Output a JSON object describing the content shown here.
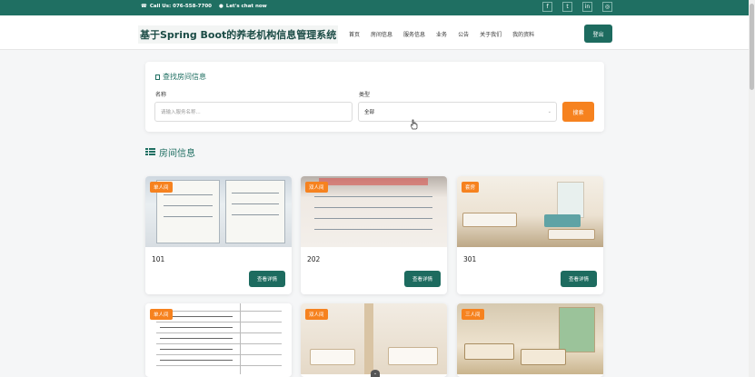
{
  "topbar": {
    "phone": "Call Us: 076-558-7700",
    "chat": "Let's chat now",
    "socials": [
      "facebook-icon",
      "twitter-icon",
      "linkedin-icon",
      "instagram-icon"
    ]
  },
  "header": {
    "site_title": "基于Spring Boot的养老机构信息管理系统",
    "nav": [
      "首页",
      "房间信息",
      "服务信息",
      "业务",
      "公告",
      "关于我们",
      "我的资料"
    ],
    "logout": "登出"
  },
  "search": {
    "title": "查找房间信息",
    "name_label": "名称",
    "name_placeholder": "请输入服务名称...",
    "type_label": "类型",
    "type_value": "全部",
    "button": "搜索"
  },
  "section_title": "房间信息",
  "rooms": [
    {
      "badge": "单人间",
      "number": "101",
      "button": "查看详情"
    },
    {
      "badge": "双人间",
      "number": "202",
      "button": "查看详情"
    },
    {
      "badge": "套房",
      "number": "301",
      "button": "查看详情"
    },
    {
      "badge": "单人间"
    },
    {
      "badge": "双人间"
    },
    {
      "badge": "三人间"
    }
  ],
  "colors": {
    "brand": "#1f6f62",
    "accent": "#f6821f"
  }
}
